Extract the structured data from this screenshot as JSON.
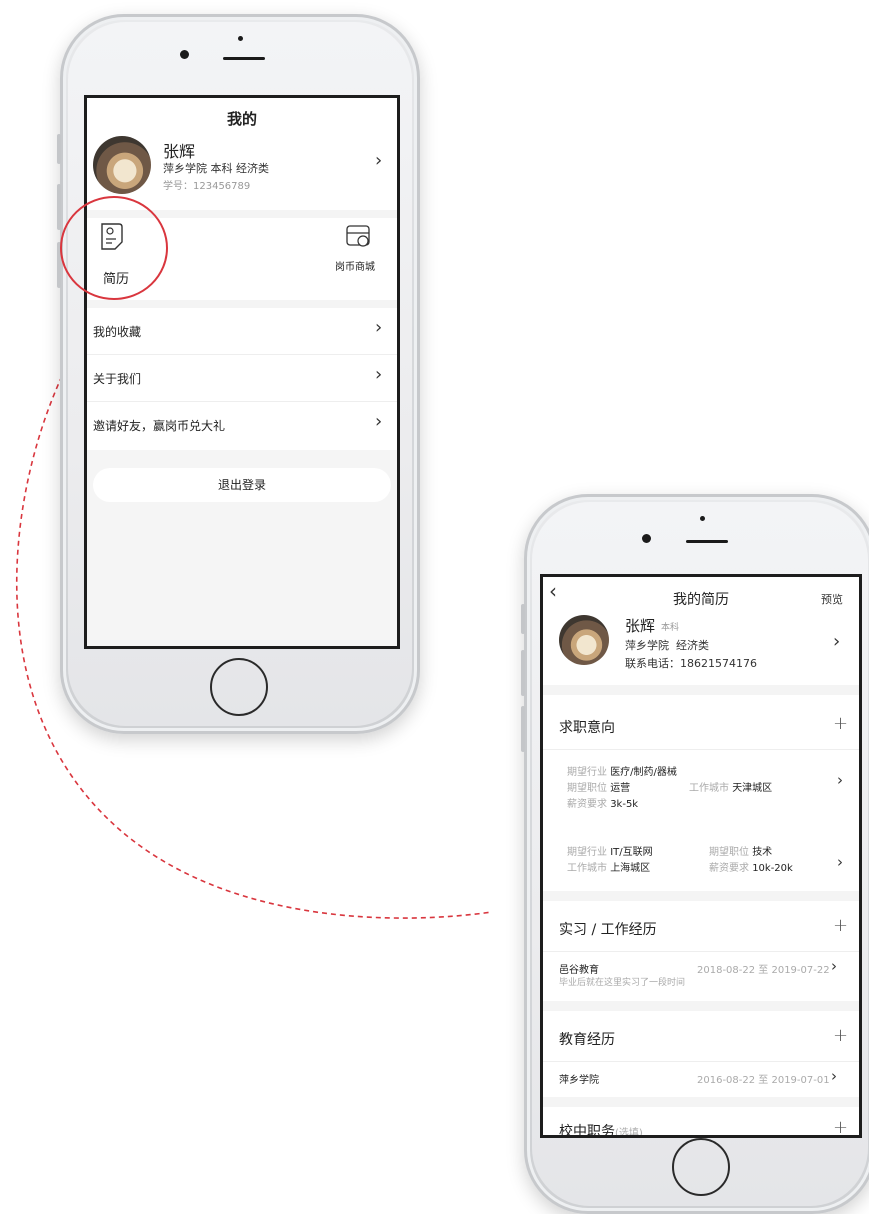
{
  "profile_screen": {
    "title": "我的",
    "user": {
      "name": "张辉",
      "school_line": "萍乡学院 本科 经济类",
      "student_id": "学号：123456789"
    },
    "shortcuts": [
      {
        "label": "简历",
        "icon": "resume-icon"
      },
      {
        "label": "岗币商城",
        "icon": "coin-mall-icon"
      }
    ],
    "menu": [
      {
        "label": "我的收藏"
      },
      {
        "label": "关于我们"
      },
      {
        "label": "邀请好友，赢岗币兑大礼"
      }
    ],
    "logout_label": "退出登录"
  },
  "resume_screen": {
    "title": "我的简历",
    "preview_label": "预览",
    "user": {
      "name": "张辉",
      "degree": "本科",
      "school_line": "萍乡学院  经济类",
      "phone": "联系电话：18621574176"
    },
    "job_intent": {
      "title": "求职意向",
      "entries": [
        {
          "industry_label": "期望行业",
          "industry": "医疗/制药/器械",
          "position_label": "期望职位",
          "position": "运营",
          "city_label": "工作城市",
          "city": "天津城区",
          "salary_label": "薪资要求",
          "salary": "3k-5k"
        },
        {
          "industry_label": "期望行业",
          "industry": "IT/互联网",
          "position_label": "期望职位",
          "position": "技术",
          "city_label": "工作城市",
          "city": "上海城区",
          "salary_label": "薪资要求",
          "salary": "10k-20k"
        }
      ]
    },
    "work": {
      "title": "实习 / 工作经历",
      "entries": [
        {
          "org": "邑谷教育",
          "dates": "2018-08-22 至 2019-07-22",
          "desc": "毕业后就在这里实习了一段时间"
        }
      ]
    },
    "education": {
      "title": "教育经历",
      "entries": [
        {
          "org": "萍乡学院",
          "dates": "2016-08-22 至 2019-07-01"
        }
      ]
    },
    "campus_role": {
      "title": "校中职务",
      "hint": "(选填)"
    }
  },
  "colors": {
    "highlight_circle": "#d9363e",
    "connector": "#d9363e"
  }
}
